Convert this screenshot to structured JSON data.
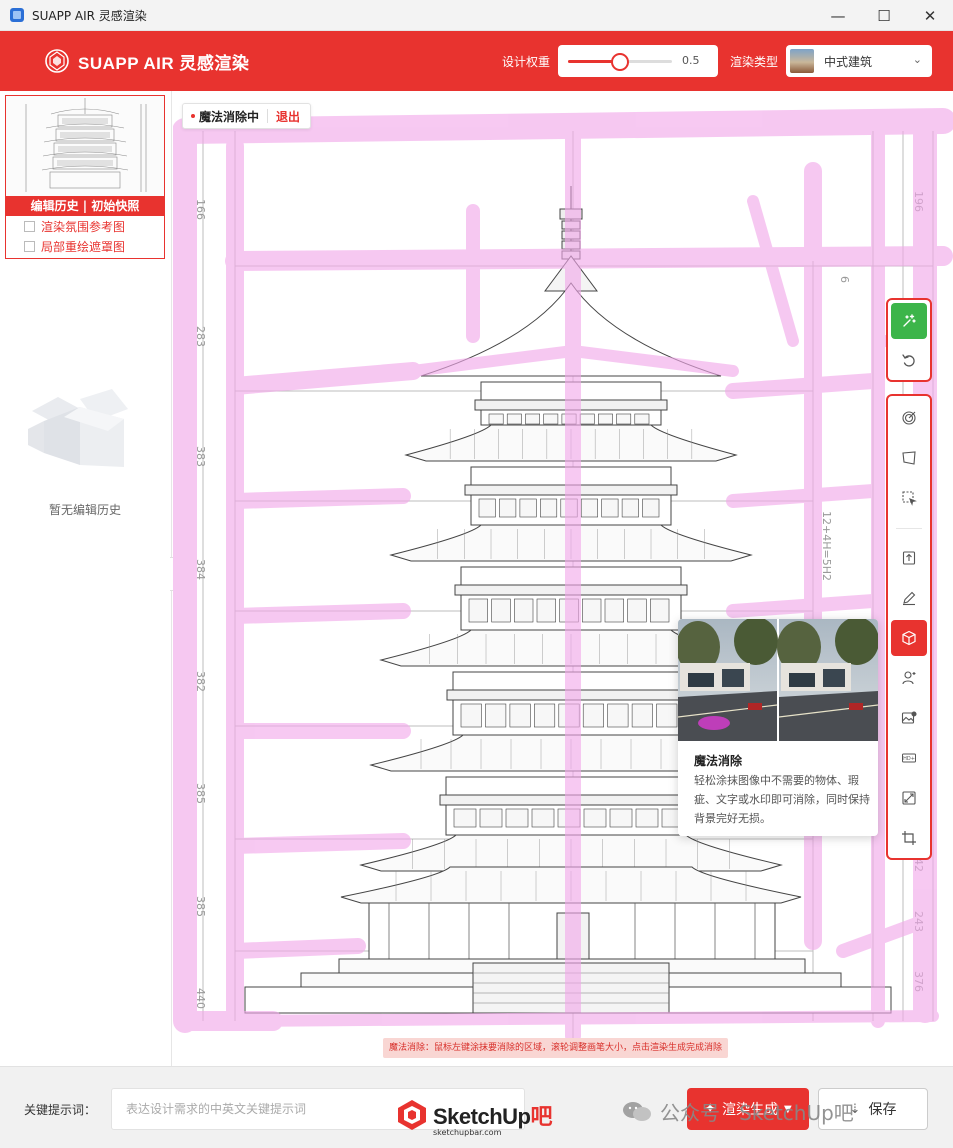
{
  "window": {
    "title": "SUAPP AIR 灵感渲染",
    "minimize_glyph": "—",
    "maximize_glyph": "☐",
    "close_glyph": "✕"
  },
  "header": {
    "brand": "SUAPP AIR 灵感渲染",
    "weight_label": "设计权重",
    "weight_value": 0.5,
    "weight_value_text": "0.5",
    "render_type_label": "渲染类型",
    "render_type_value": "中式建筑"
  },
  "sidebar": {
    "history_title": "编辑历史 | 初始快照",
    "options": [
      {
        "label": "渲染氛围参考图",
        "checked": false
      },
      {
        "label": "局部重绘遮罩图",
        "checked": false
      }
    ],
    "empty_text": "暂无编辑历史"
  },
  "canvas": {
    "magic_tag": "魔法消除中",
    "magic_exit": "退出",
    "hint": "魔法消除：鼠标左键涂抹要消除的区域，滚轮调整画笔大小，点击渲染生成完成消除",
    "dimension_labels": [
      "166",
      "283",
      "383",
      "384",
      "382",
      "385",
      "385",
      "440"
    ],
    "right_dimension_labels": [
      "196",
      "6",
      "12+4H=5H2",
      "442",
      "243",
      "376"
    ]
  },
  "toolbar": {
    "tools": [
      {
        "name": "magic-eraser",
        "icon": "sparkle-icon",
        "active": true
      },
      {
        "name": "undo",
        "icon": "undo-icon",
        "active": false
      },
      {
        "name": "target",
        "icon": "target-icon",
        "active": false
      },
      {
        "name": "perspective",
        "icon": "perspective-icon",
        "active": false
      },
      {
        "name": "select-region",
        "icon": "select-region-icon",
        "active": false
      },
      {
        "name": "upload",
        "icon": "upload-icon",
        "active": false
      },
      {
        "name": "sketch",
        "icon": "pen-icon",
        "active": false
      },
      {
        "name": "material",
        "icon": "cube-icon",
        "active": true
      },
      {
        "name": "person",
        "icon": "person-icon",
        "active": false
      },
      {
        "name": "image-edit",
        "icon": "image-icon",
        "active": false
      },
      {
        "name": "hd",
        "icon": "hd-icon",
        "active": false
      },
      {
        "name": "expand",
        "icon": "expand-icon",
        "active": false
      },
      {
        "name": "crop",
        "icon": "crop-icon",
        "active": false
      }
    ]
  },
  "tooltip": {
    "title": "魔法消除",
    "description": "轻松涂抹图像中不需要的物体、瑕疵、文字或水印即可消除，同时保持背景完好无损。"
  },
  "bottom": {
    "prompt_label": "关键提示词：",
    "prompt_placeholder": "表达设计需求的中英文关键提示词",
    "prompt_value": "",
    "generate_label": "渲染生成",
    "save_label": "保存",
    "watermark_main": "SketchUp",
    "watermark_accent": "吧",
    "watermark_sub": "sketchupbar.com",
    "wechat_text": "公众号 · SketchUp吧"
  },
  "colors": {
    "accent": "#e8332f",
    "mask": "#f7c6f1",
    "active_green": "#3cb54a"
  }
}
